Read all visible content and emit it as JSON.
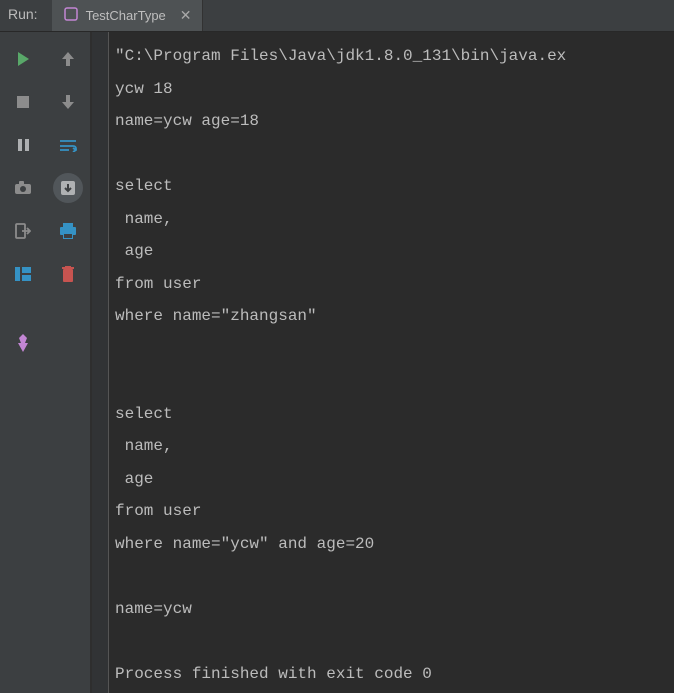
{
  "header": {
    "run_label": "Run:",
    "tab_name": "TestCharType"
  },
  "console": {
    "lines": [
      "\"C:\\Program Files\\Java\\jdk1.8.0_131\\bin\\java.ex",
      "ycw 18",
      "name=ycw age=18",
      "",
      "select",
      " name,",
      " age",
      "from user",
      "where name=\"zhangsan\"",
      "",
      "",
      "select",
      " name,",
      " age",
      "from user",
      "where name=\"ycw\" and age=20",
      "",
      "name=ycw",
      "",
      "Process finished with exit code 0"
    ]
  },
  "icons": {
    "run": "run-icon",
    "up": "arrow-up-icon",
    "stop": "stop-icon",
    "down": "arrow-down-icon",
    "pause": "pause-icon",
    "wrap": "soft-wrap-icon",
    "camera": "camera-icon",
    "download": "download-icon",
    "exit": "exit-icon",
    "print": "print-icon",
    "layout": "layout-icon",
    "trash": "trash-icon",
    "pin": "pin-icon"
  }
}
